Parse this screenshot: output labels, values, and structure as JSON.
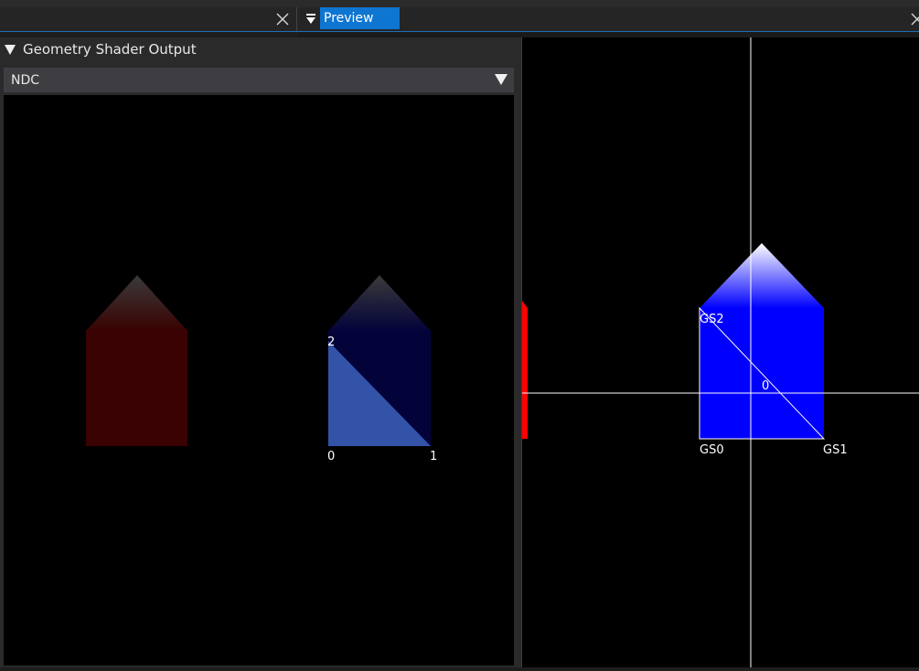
{
  "left_tab": {
    "close_icon": "close-icon"
  },
  "preview_tab": {
    "menu_icon": "dropdown-menu-icon",
    "label": "Preview",
    "close_icon": "close-icon",
    "active_color": "#0e75d1"
  },
  "gs_panel": {
    "title": "Geometry Shader Output",
    "collapse_icon": "collapse-triangle-icon",
    "space_select": {
      "value": "NDC",
      "arrow_icon": "dropdown-arrow-icon"
    },
    "labels": {
      "v0": "0",
      "v1": "1",
      "v2": "2"
    }
  },
  "preview": {
    "labels": {
      "gs0": "GS0",
      "gs1": "GS1",
      "gs2": "GS2",
      "center": "0"
    }
  }
}
